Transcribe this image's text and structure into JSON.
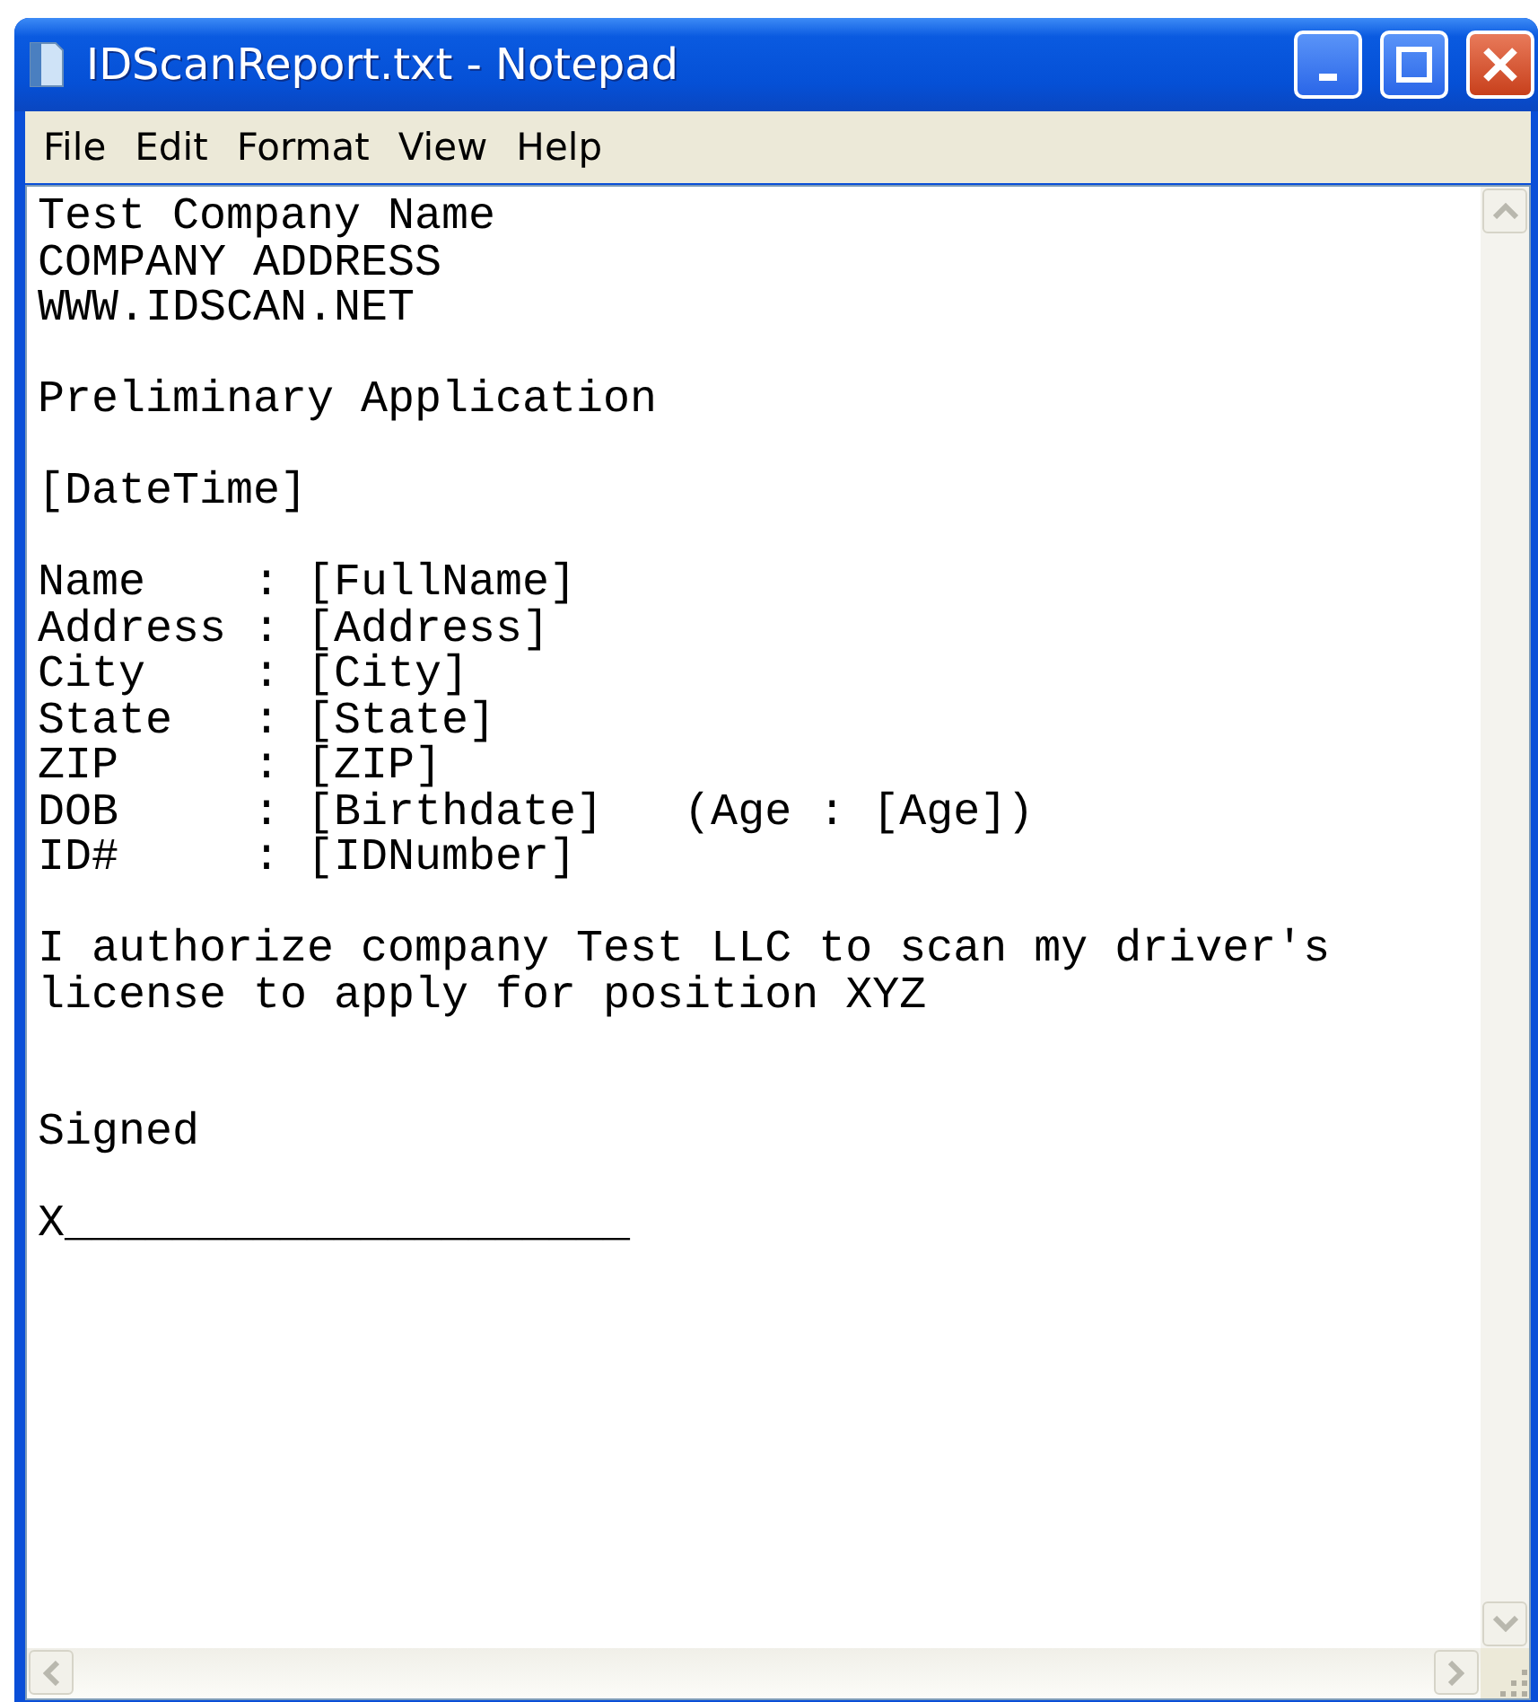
{
  "window": {
    "title": "IDScanReport.txt - Notepad"
  },
  "menu": [
    {
      "label": "File"
    },
    {
      "label": "Edit"
    },
    {
      "label": "Format"
    },
    {
      "label": "View"
    },
    {
      "label": "Help"
    }
  ],
  "document": {
    "paragraphs": [
      {
        "kind": "first",
        "lines": [
          "Test Company Name",
          "COMPANY ADDRESS",
          "WWW.IDSCAN.NET"
        ]
      },
      {
        "kind": "gap",
        "lines": [
          "Preliminary Application"
        ]
      },
      {
        "kind": "gap",
        "lines": [
          "[DateTime]"
        ]
      },
      {
        "kind": "gap",
        "lines": [
          "Name    : [FullName]",
          "Address : [Address]",
          "City    : [City]",
          "State   : [State]",
          "ZIP     : [ZIP]",
          "DOB     : [Birthdate]   (Age : [Age])",
          "ID#     : [IDNumber]"
        ]
      },
      {
        "kind": "gap",
        "lines": [
          "I authorize company Test LLC to scan my driver's",
          "license to apply for position XYZ"
        ]
      },
      {
        "kind": "wide-gap",
        "lines": [
          "Signed"
        ]
      },
      {
        "kind": "gap",
        "lines": [
          "X_____________________"
        ]
      }
    ]
  }
}
